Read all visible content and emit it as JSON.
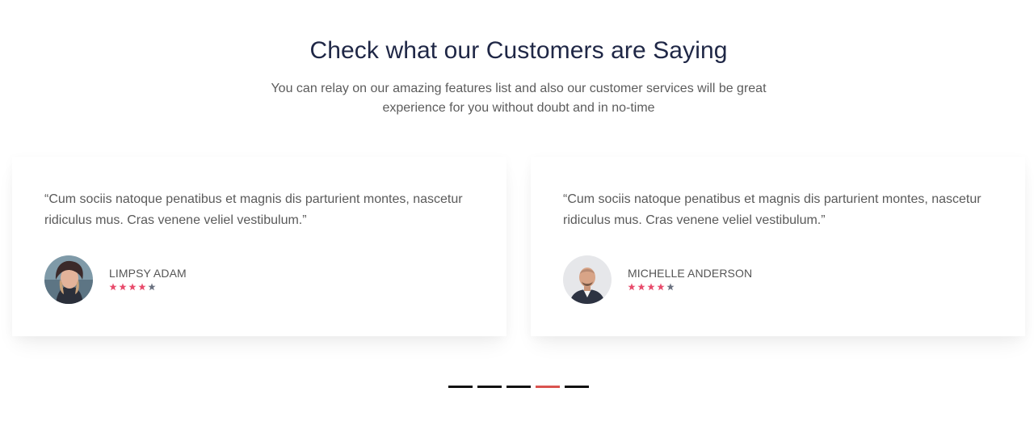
{
  "header": {
    "title": "Check what our Customers are Saying",
    "subtitle_line1": "You can relay on our amazing features list and also our customer services will be great",
    "subtitle_line2": "experience for you without doubt and in no-time"
  },
  "testimonials": [
    {
      "quote_line1": "“Cum sociis natoque penatibus et magnis dis parturient montes, nascetur",
      "quote_line2": "ridiculus mus. Cras venene veliel vestibulum.”",
      "name": "LIMPSY ADAM",
      "rating": 4,
      "max_rating": 5
    },
    {
      "quote_line1": "“Cum sociis natoque penatibus et magnis dis parturient montes, nascetur",
      "quote_line2": "ridiculus mus. Cras venene veliel vestibulum.”",
      "name": "MICHELLE ANDERSON",
      "rating": 4,
      "max_rating": 5
    }
  ],
  "pagination": {
    "count": 5,
    "active_index": 3
  },
  "colors": {
    "title": "#1f2746",
    "star_filled": "#e84c6c",
    "star_empty": "#6b7280",
    "dot": "#111111",
    "dot_active": "#d9534f"
  },
  "icons": {
    "star": "star-icon"
  }
}
